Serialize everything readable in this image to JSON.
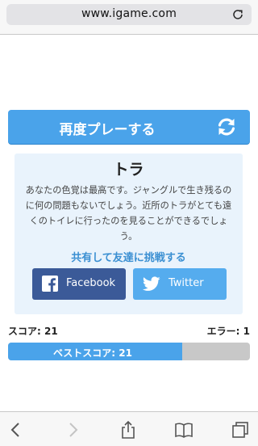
{
  "browser": {
    "url": "www.igame.com"
  },
  "game": {
    "replay_label": "再度プレーする",
    "result": {
      "animal": "トラ",
      "description": "あなたの色覚は最高です。ジャングルで生き残るのに何の問題もないでしょう。近所のトラがとても遠くのトイレに行ったのを見ることができるでしょう。"
    },
    "share": {
      "prompt": "共有して友達に挑戦する",
      "facebook_label": "Facebook",
      "twitter_label": "Twitter"
    },
    "stats": {
      "score_label": "スコア: 21",
      "errors_label": "エラー: 1",
      "best_label": "ベストスコア: 21",
      "best_progress": 0.72
    }
  },
  "colors": {
    "accent": "#4aa3ea",
    "card_bg": "#e9f3fc",
    "facebook": "#3b5a98",
    "twitter": "#55acee",
    "track": "#c8c8c8"
  },
  "icons": {
    "reload": "reload-icon",
    "replay": "refresh-icon",
    "facebook": "facebook-icon",
    "twitter": "twitter-icon",
    "back": "chevron-left-icon",
    "forward": "chevron-right-icon",
    "share": "share-icon",
    "bookmarks": "book-icon",
    "tabs": "tabs-icon"
  }
}
